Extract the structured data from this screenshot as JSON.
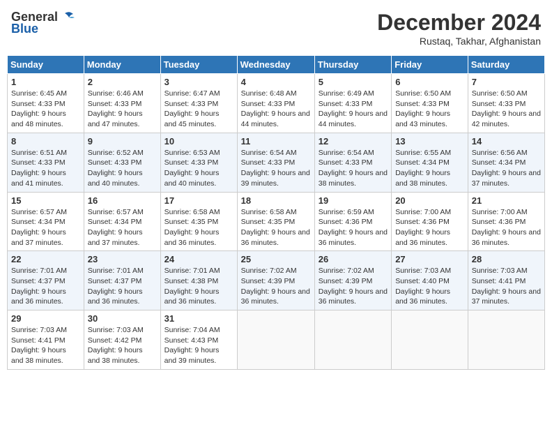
{
  "header": {
    "logo_general": "General",
    "logo_blue": "Blue",
    "month_title": "December 2024",
    "location": "Rustaq, Takhar, Afghanistan"
  },
  "days_of_week": [
    "Sunday",
    "Monday",
    "Tuesday",
    "Wednesday",
    "Thursday",
    "Friday",
    "Saturday"
  ],
  "weeks": [
    [
      {
        "day": "1",
        "sunrise": "6:45 AM",
        "sunset": "4:33 PM",
        "daylight": "9 hours and 48 minutes."
      },
      {
        "day": "2",
        "sunrise": "6:46 AM",
        "sunset": "4:33 PM",
        "daylight": "9 hours and 47 minutes."
      },
      {
        "day": "3",
        "sunrise": "6:47 AM",
        "sunset": "4:33 PM",
        "daylight": "9 hours and 45 minutes."
      },
      {
        "day": "4",
        "sunrise": "6:48 AM",
        "sunset": "4:33 PM",
        "daylight": "9 hours and 44 minutes."
      },
      {
        "day": "5",
        "sunrise": "6:49 AM",
        "sunset": "4:33 PM",
        "daylight": "9 hours and 44 minutes."
      },
      {
        "day": "6",
        "sunrise": "6:50 AM",
        "sunset": "4:33 PM",
        "daylight": "9 hours and 43 minutes."
      },
      {
        "day": "7",
        "sunrise": "6:50 AM",
        "sunset": "4:33 PM",
        "daylight": "9 hours and 42 minutes."
      }
    ],
    [
      {
        "day": "8",
        "sunrise": "6:51 AM",
        "sunset": "4:33 PM",
        "daylight": "9 hours and 41 minutes."
      },
      {
        "day": "9",
        "sunrise": "6:52 AM",
        "sunset": "4:33 PM",
        "daylight": "9 hours and 40 minutes."
      },
      {
        "day": "10",
        "sunrise": "6:53 AM",
        "sunset": "4:33 PM",
        "daylight": "9 hours and 40 minutes."
      },
      {
        "day": "11",
        "sunrise": "6:54 AM",
        "sunset": "4:33 PM",
        "daylight": "9 hours and 39 minutes."
      },
      {
        "day": "12",
        "sunrise": "6:54 AM",
        "sunset": "4:33 PM",
        "daylight": "9 hours and 38 minutes."
      },
      {
        "day": "13",
        "sunrise": "6:55 AM",
        "sunset": "4:34 PM",
        "daylight": "9 hours and 38 minutes."
      },
      {
        "day": "14",
        "sunrise": "6:56 AM",
        "sunset": "4:34 PM",
        "daylight": "9 hours and 37 minutes."
      }
    ],
    [
      {
        "day": "15",
        "sunrise": "6:57 AM",
        "sunset": "4:34 PM",
        "daylight": "9 hours and 37 minutes."
      },
      {
        "day": "16",
        "sunrise": "6:57 AM",
        "sunset": "4:34 PM",
        "daylight": "9 hours and 37 minutes."
      },
      {
        "day": "17",
        "sunrise": "6:58 AM",
        "sunset": "4:35 PM",
        "daylight": "9 hours and 36 minutes."
      },
      {
        "day": "18",
        "sunrise": "6:58 AM",
        "sunset": "4:35 PM",
        "daylight": "9 hours and 36 minutes."
      },
      {
        "day": "19",
        "sunrise": "6:59 AM",
        "sunset": "4:36 PM",
        "daylight": "9 hours and 36 minutes."
      },
      {
        "day": "20",
        "sunrise": "7:00 AM",
        "sunset": "4:36 PM",
        "daylight": "9 hours and 36 minutes."
      },
      {
        "day": "21",
        "sunrise": "7:00 AM",
        "sunset": "4:36 PM",
        "daylight": "9 hours and 36 minutes."
      }
    ],
    [
      {
        "day": "22",
        "sunrise": "7:01 AM",
        "sunset": "4:37 PM",
        "daylight": "9 hours and 36 minutes."
      },
      {
        "day": "23",
        "sunrise": "7:01 AM",
        "sunset": "4:37 PM",
        "daylight": "9 hours and 36 minutes."
      },
      {
        "day": "24",
        "sunrise": "7:01 AM",
        "sunset": "4:38 PM",
        "daylight": "9 hours and 36 minutes."
      },
      {
        "day": "25",
        "sunrise": "7:02 AM",
        "sunset": "4:39 PM",
        "daylight": "9 hours and 36 minutes."
      },
      {
        "day": "26",
        "sunrise": "7:02 AM",
        "sunset": "4:39 PM",
        "daylight": "9 hours and 36 minutes."
      },
      {
        "day": "27",
        "sunrise": "7:03 AM",
        "sunset": "4:40 PM",
        "daylight": "9 hours and 36 minutes."
      },
      {
        "day": "28",
        "sunrise": "7:03 AM",
        "sunset": "4:41 PM",
        "daylight": "9 hours and 37 minutes."
      }
    ],
    [
      {
        "day": "29",
        "sunrise": "7:03 AM",
        "sunset": "4:41 PM",
        "daylight": "9 hours and 38 minutes."
      },
      {
        "day": "30",
        "sunrise": "7:03 AM",
        "sunset": "4:42 PM",
        "daylight": "9 hours and 38 minutes."
      },
      {
        "day": "31",
        "sunrise": "7:04 AM",
        "sunset": "4:43 PM",
        "daylight": "9 hours and 39 minutes."
      },
      null,
      null,
      null,
      null
    ]
  ]
}
